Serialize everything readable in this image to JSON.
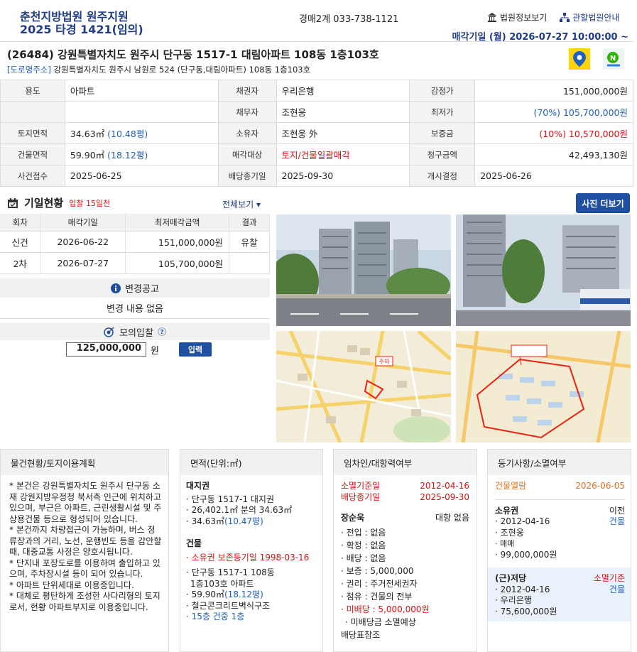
{
  "header": {
    "court": "춘천지방법원 원주지원",
    "case_no": "2025 타경 1421(임의)",
    "phone": "경매2계 033-738-1121",
    "link_info": "법원정보보기",
    "link_court": "관할법원안내",
    "sale_date": "매각기일 (월) 2026-07-27 10:00:00 ~"
  },
  "address": {
    "main": "(26484) 강원특별자치도 원주시 단구동 1517-1 대림아파트 108동 1층103호",
    "road_tag": "[도로명주소]",
    "road": "강원특별자치도 원주시 남원로 524 (단구동,대림아파트) 108동 1층103호"
  },
  "info": {
    "usage_label": "용도",
    "usage": "아파트",
    "creditor_label": "채권자",
    "creditor": "우리은행",
    "appraisal_label": "감정가",
    "appraisal": "151,000,000원",
    "debtor_label": "채무자",
    "debtor": "조현웅",
    "min_label": "최저가",
    "min": "(70%) 105,700,000원",
    "land_label": "토지면적",
    "land": "34.63㎡",
    "land_py": "(10.48평)",
    "owner_label": "소유자",
    "owner": "조현웅 外",
    "deposit_label": "보증금",
    "deposit": "(10%) 10,570,000원",
    "bldg_label": "건물면적",
    "bldg": "59.90㎡",
    "bldg_py": "(18.12평)",
    "target_label": "매각대상",
    "target": "토지/건물일괄매각",
    "claim_label": "청구금액",
    "claim": "42,493,130원",
    "filed_label": "사건접수",
    "filed": "2025-06-25",
    "dist_label": "배당종기일",
    "dist": "2025-09-30",
    "start_label": "개시결정",
    "start": "2025-06-26"
  },
  "schedule": {
    "title": "기일현황",
    "sub": "입찰 15일전",
    "all_view": "전체보기",
    "photo_more": "사진 더보기",
    "headers": [
      "회차",
      "매각기일",
      "최저매각금액",
      "결과"
    ],
    "rows": [
      {
        "round": "신건",
        "date": "2026-06-22",
        "price": "151,000,000원",
        "result": "유찰"
      },
      {
        "round": "2차",
        "date": "2026-07-27",
        "price": "105,700,000원",
        "result": ""
      }
    ]
  },
  "notice": {
    "title": "변경공고",
    "body": "변경 내용 없음"
  },
  "mock": {
    "title": "모의입찰",
    "value": "125,000,000",
    "unit": "원",
    "button": "입력"
  },
  "map_label": "주하",
  "col1": {
    "title": "물건현황/토지이용계획",
    "items": [
      "* 본건은 강원특별자치도 원주시 단구동 소재 강원지방우정청 북서측 인근에 위치하고 있으며, 부근은 아파트, 근린생활시설 및 주상용건물 등으로 형성되어 있습니다.",
      "* 본건까지 차량접근이 가능하며, 버스 정류장과의 거리, 노선, 운행빈도 등을 감안할 때, 대중교통 사정은 양호시됩니다.",
      "* 단지내 포장도로를 이용하여 출입하고 있으며, 주차장시설 등이 되어 있습니다.",
      "* 아파트 단위세대로 이용중입니다.",
      "* 대체로 평탄하게 조성한 사다리형의 토지로서, 현황 아파트부지로 이용중입니다."
    ]
  },
  "col2": {
    "title": "면적(단위:㎡)",
    "land_title": "대지권",
    "land_1": "단구동 1517-1 대지권",
    "land_2": "26,402.1㎡ 분의 34.63㎡",
    "land_3": "34.63㎡",
    "land_3_py": "(10.47평)",
    "bldg_title": "건물",
    "bldg_reg": "소유권 보존등기일 1998-03-16",
    "bldg_1": "단구동 1517-1 108동",
    "bldg_2": "1층103호 아파트",
    "bldg_3": "59.90㎡",
    "bldg_3_py": "(18.12평)",
    "bldg_4": "철근콘크리트벽식구조",
    "bldg_5": "15층 건중 1층"
  },
  "col3": {
    "title": "임차인/대항력여부",
    "base_label": "소멸기준일",
    "base_date": "2012-04-16",
    "dist_label": "배당종기일",
    "dist_date": "2025-09-30",
    "tenant": "장순욱",
    "tenant_status": "대항 없음",
    "lines": [
      "전입 : 없음",
      "확정 : 없음",
      "배당 : 없음",
      "보증 : 5,000,000",
      "권리 : 주거전세권자",
      "점유 : 건물의 전부"
    ],
    "unpaid": "미배당 : 5,000,000원",
    "note1": "미배당금 소멸예상",
    "note2": "배당표참조"
  },
  "col4": {
    "title": "등기사항/소멸여부",
    "view_label": "건물열람",
    "view_date": "2026-06-05",
    "e1_title": "소유권",
    "e1_status": "이전",
    "e1_date": "2012-04-16",
    "e1_type": "건물",
    "e1_name": "조현웅",
    "e1_cause": "매매",
    "e1_amount": "99,000,000원",
    "e2_title": "(근)저당",
    "e2_status": "소멸기준",
    "e2_date": "2012-04-16",
    "e2_type": "건물",
    "e2_name": "우리은행",
    "e2_amount": "75,600,000원"
  }
}
